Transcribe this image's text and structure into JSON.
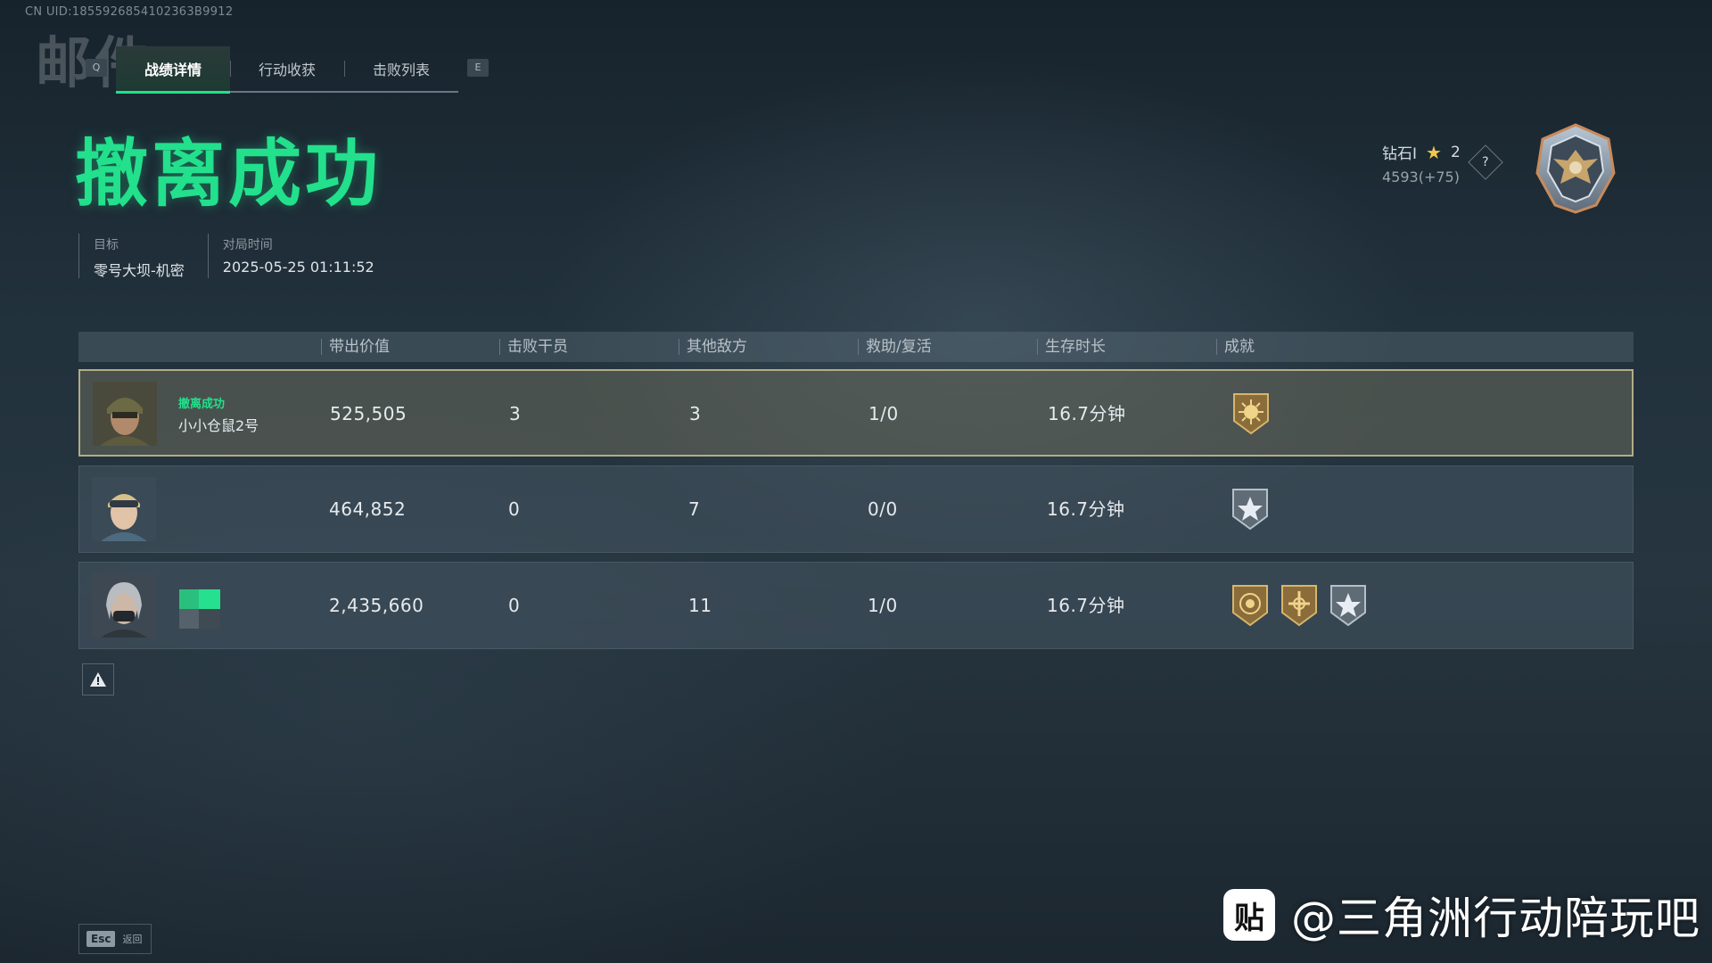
{
  "uid": "CN UID:1855926854102363B9912",
  "mail_watermark": "邮件",
  "tabbar": {
    "left_key": "Q",
    "right_key": "E",
    "tabs": [
      {
        "label": "战绩详情",
        "active": true
      },
      {
        "label": "行动收获",
        "active": false
      },
      {
        "label": "击败列表",
        "active": false
      }
    ]
  },
  "title": "撤离成功",
  "meta": {
    "target_label": "目标",
    "target_value": "零号大坝-机密",
    "time_label": "对局时间",
    "time_value": "2025-05-25 01:11:52"
  },
  "rank": {
    "tier": "钻石I",
    "stars": "2",
    "score": "4593(+75)",
    "help": "?"
  },
  "table": {
    "headers": [
      "带出价值",
      "击败干员",
      "其他敌方",
      "救助/复活",
      "生存时长",
      "成就"
    ],
    "rows": [
      {
        "status": "撤离成功",
        "name": "小小仓鼠2号",
        "value": "525,505",
        "kills": "3",
        "others": "3",
        "assist": "1/0",
        "survival": "16.7分钟",
        "achievements": [
          "gold-sun-badge"
        ]
      },
      {
        "status": "",
        "name": "",
        "value": "464,852",
        "kills": "0",
        "others": "7",
        "assist": "0/0",
        "survival": "16.7分钟",
        "achievements": [
          "silver-star-badge"
        ]
      },
      {
        "status": "",
        "name": "",
        "value": "2,435,660",
        "kills": "0",
        "others": "11",
        "assist": "1/0",
        "survival": "16.7分钟",
        "achievements": [
          "gold-target-badge",
          "gold-cross-badge",
          "silver-star-badge"
        ]
      }
    ]
  },
  "footer": {
    "esc_key": "Esc",
    "esc_label": "返回"
  },
  "watermark": {
    "icon_text": "贴",
    "text": "@三角洲行动陪玩吧"
  },
  "colors": {
    "accent_green": "#22e08c",
    "gold": "#c9a85a",
    "silver": "#9aa6b0"
  }
}
